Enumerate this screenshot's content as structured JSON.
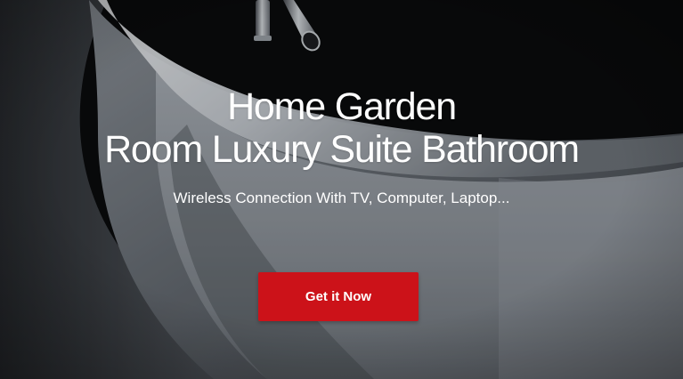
{
  "hero": {
    "title_line_1": "Home Garden",
    "title_line_2": "Room Luxury Suite Bathroom",
    "subtitle": "Wireless Connection With TV, Computer, Laptop...",
    "button_label": "Get it Now"
  },
  "colors": {
    "background_dark": "#0b0c0e",
    "tub_light": "#d9dde2",
    "tub_shadow": "#5c6168",
    "button_red": "#cc1219",
    "text": "#ffffff"
  },
  "icons": {
    "faucet": "faucet-icon"
  }
}
